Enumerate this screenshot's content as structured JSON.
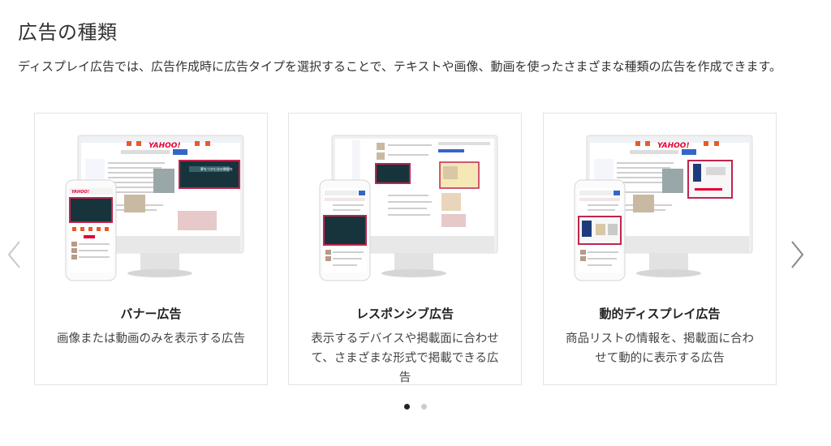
{
  "section": {
    "title": "広告の種類",
    "description": "ディスプレイ広告では、広告作成時に広告タイプを選択することで、テキストや画像、動画を使ったさまざまな種類の広告を作成できます。"
  },
  "cards": [
    {
      "title": "バナー広告",
      "description": "画像または動画のみを表示する広告",
      "image_logo": "YAHOO!",
      "image_ad_text": "夢をつかむ次の瞬間を"
    },
    {
      "title": "レスポンシブ広告",
      "description": "表示するデバイスや掲載面に合わせて、さまざまな形式で掲載できる広告"
    },
    {
      "title": "動的ディスプレイ広告",
      "description": "商品リストの情報を、掲載面に合わせて動的に表示する広告",
      "image_logo": "YAHOO!"
    }
  ],
  "carousel": {
    "active_index": 0,
    "page_count": 2,
    "prev_icon": "chevron-left-icon",
    "next_icon": "chevron-right-icon"
  },
  "colors": {
    "highlight": "#c0254d",
    "link_blue": "#3466c8",
    "yahoo_red": "#e60033"
  }
}
